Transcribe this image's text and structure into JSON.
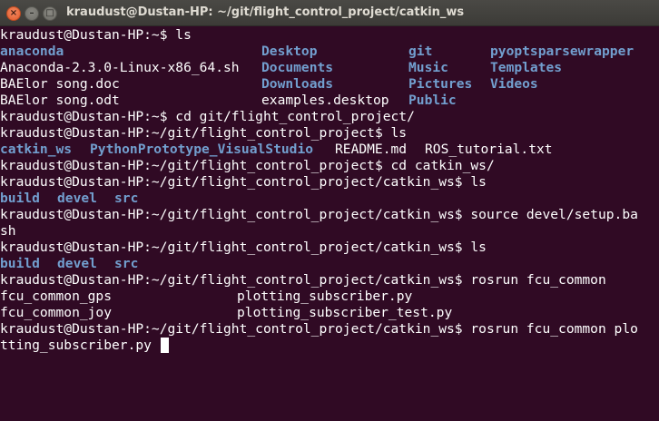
{
  "window": {
    "title": "kraudust@Dustan-HP: ~/git/flight_control_project/catkin_ws",
    "close_glyph": "×",
    "minimize_glyph": "–",
    "maximize_glyph": "□"
  },
  "colors": {
    "background": "#300a24",
    "text": "#ffffff",
    "directory": "#729fcf",
    "close_button": "#e95420",
    "titlebar": "#3c3b37"
  },
  "terminal": {
    "lines": [
      "kraudust@Dustan-HP:~$ ls",
      "",
      "",
      "",
      "",
      "kraudust@Dustan-HP:~$ cd git/flight_control_project/",
      "kraudust@Dustan-HP:~/git/flight_control_project$ ls",
      "",
      "kraudust@Dustan-HP:~/git/flight_control_project$ cd catkin_ws/",
      "kraudust@Dustan-HP:~/git/flight_control_project/catkin_ws$ ls",
      "",
      "kraudust@Dustan-HP:~/git/flight_control_project/catkin_ws$ source devel/setup.ba",
      "sh",
      "kraudust@Dustan-HP:~/git/flight_control_project/catkin_ws$ ls",
      "",
      "kraudust@Dustan-HP:~/git/flight_control_project/catkin_ws$ rosrun fcu_common",
      "",
      "",
      "kraudust@Dustan-HP:~/git/flight_control_project/catkin_ws$ rosrun fcu_common plo",
      "tting_subscriber.py "
    ],
    "home_ls": [
      [
        {
          "text": "anaconda",
          "type": "dir"
        },
        {
          "text": "Desktop",
          "type": "dir"
        },
        {
          "text": "git",
          "type": "dir"
        },
        {
          "text": "pyoptsparsewrapper",
          "type": "dir"
        }
      ],
      [
        {
          "text": "Anaconda-2.3.0-Linux-x86_64.sh",
          "type": "file"
        },
        {
          "text": "Documents",
          "type": "dir"
        },
        {
          "text": "Music",
          "type": "dir"
        },
        {
          "text": "Templates",
          "type": "dir"
        }
      ],
      [
        {
          "text": "BAElor song.doc",
          "type": "file"
        },
        {
          "text": "Downloads",
          "type": "dir"
        },
        {
          "text": "Pictures",
          "type": "dir"
        },
        {
          "text": "Videos",
          "type": "dir"
        }
      ],
      [
        {
          "text": "BAElor song.odt",
          "type": "file"
        },
        {
          "text": "examples.desktop",
          "type": "file"
        },
        {
          "text": "Public",
          "type": "dir"
        },
        {
          "text": "",
          "type": "file"
        }
      ]
    ],
    "project_ls": [
      {
        "text": "catkin_ws",
        "type": "dir"
      },
      {
        "text": "PythonPrototype_VisualStudio",
        "type": "dir"
      },
      {
        "text": "README.md",
        "type": "file"
      },
      {
        "text": "ROS_tutorial.txt",
        "type": "file"
      }
    ],
    "catkin_ls": [
      {
        "text": "build",
        "type": "dir"
      },
      {
        "text": "devel",
        "type": "dir"
      },
      {
        "text": "src",
        "type": "dir"
      }
    ],
    "completions": [
      [
        "fcu_common_gps",
        "plotting_subscriber.py"
      ],
      [
        "fcu_common_joy",
        "plotting_subscriber_test.py"
      ]
    ]
  }
}
